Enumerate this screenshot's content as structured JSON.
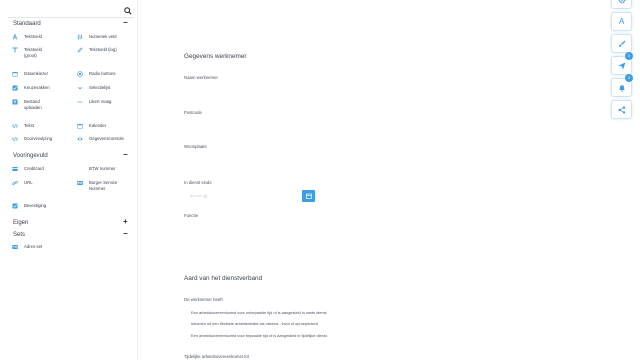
{
  "sidebar": {
    "search": {
      "placeholder": "",
      "icon": "search-icon"
    },
    "groups": [
      {
        "title": "Standaard",
        "toggle": "−"
      },
      {
        "title": "Vooringevuld",
        "toggle": "−"
      },
      {
        "title": "Eigen",
        "toggle": "+"
      },
      {
        "title": "Sets",
        "toggle": "−"
      }
    ],
    "standaard_items": [
      {
        "label": "Tekstveld",
        "icon": "text-a-icon"
      },
      {
        "label": "Numeriek veld",
        "icon": "hash-icon"
      },
      {
        "label": "Tekstveld (groot)",
        "icon": "text-large-icon"
      },
      {
        "label": "Tekstveld (log)",
        "icon": "edit-icon"
      },
      {
        "label": "Datumkiezer",
        "icon": "calendar-icon"
      },
      {
        "label": "Radio buttons",
        "icon": "radio-icon"
      },
      {
        "label": "Keuzevakken",
        "icon": "checkbox-icon"
      },
      {
        "label": "Selectielijst",
        "icon": "select-icon"
      },
      {
        "label": "Bestand uploaden",
        "icon": "upload-icon"
      },
      {
        "label": "Likert vraag",
        "icon": "likert-icon"
      },
      {
        "label": "Tekst",
        "icon": "code-icon"
      },
      {
        "label": "Kalender",
        "icon": "calendar-icon"
      },
      {
        "label": "Doorverwijzing",
        "icon": "code-icon"
      },
      {
        "label": "Gegevenscontrole",
        "icon": "eye-icon"
      }
    ],
    "voorinvuld_items": [
      {
        "label": "Creditcard",
        "icon": "card-icon"
      },
      {
        "label": "BTW nummer",
        "icon": "none"
      },
      {
        "label": "URL",
        "icon": "link-icon"
      },
      {
        "label": "Burger Service Nummer",
        "icon": "id-card-icon"
      },
      {
        "label": "Bevestiging",
        "icon": "checkbox-icon"
      }
    ],
    "sets_items": [
      {
        "label": "Adres set",
        "icon": "address-card-icon"
      }
    ]
  },
  "form": {
    "section1_title": "Gegevens werknemer",
    "fields": [
      {
        "label": "Naam werknemer"
      },
      {
        "label": "Postcode"
      },
      {
        "label": "Woonplaats"
      },
      {
        "label": "In dienst sinds",
        "value": "dd-mm-jjjj"
      },
      {
        "label": "Functie"
      }
    ],
    "section2_title": "Aard van het dienstverband",
    "question": "De werknemer heeft",
    "options": [
      "Een arbeidsovereenkomst voor onbepaalde tijd of is aangesteld in vaste dienst",
      "Inkomen uit een flexibele arbeidsrelatie als uitzend-, invul of oproepkracht",
      "Een arbeidsovereenkomst voor bepaalde tijd of is aangesteld in tijdelijke dienst"
    ],
    "footer_label": "Tijdelijke arbeidsovereenkomst tot"
  },
  "toolbar": {
    "buttons": [
      {
        "icon": "gear-icon",
        "glyph": ""
      },
      {
        "icon": "font-icon",
        "glyph": "A"
      },
      {
        "icon": "brush-icon",
        "glyph": ""
      },
      {
        "icon": "send-icon",
        "glyph": "",
        "badge": "0"
      },
      {
        "icon": "bell-icon",
        "glyph": "",
        "badge": "0"
      },
      {
        "icon": "share-icon",
        "glyph": ""
      }
    ]
  },
  "colors": {
    "accent": "#3b9ee6",
    "text": "#3a4250"
  }
}
